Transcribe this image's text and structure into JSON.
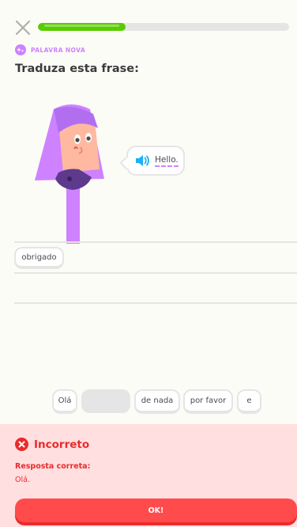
{
  "header": {
    "close_icon": "close-icon",
    "progress_fraction": 0.35
  },
  "badge": {
    "icon": "sparkle-icon",
    "label": "PALAVRA NOVA"
  },
  "title": "Traduza esta frase:",
  "character": {
    "icon": "character-illustration"
  },
  "bubble": {
    "speaker_icon": "speaker-icon",
    "word": "Hello."
  },
  "answer": {
    "selected_words": [
      "obrigado"
    ]
  },
  "word_bank": {
    "words": [
      "Olá",
      "",
      "de nada",
      "por favor",
      "e"
    ]
  },
  "feedback": {
    "icon": "x-circle-icon",
    "title": "Incorreto",
    "subtitle": "Resposta correta:",
    "correct_answer": "Olá.",
    "button_label": "OK!"
  },
  "colors": {
    "green": "#58cc02",
    "purple": "#ce82ff",
    "red": "#ea2b2b",
    "red_bg": "#ffdfe0",
    "button_red": "#ff4b4b",
    "blue": "#1cb0f6"
  }
}
